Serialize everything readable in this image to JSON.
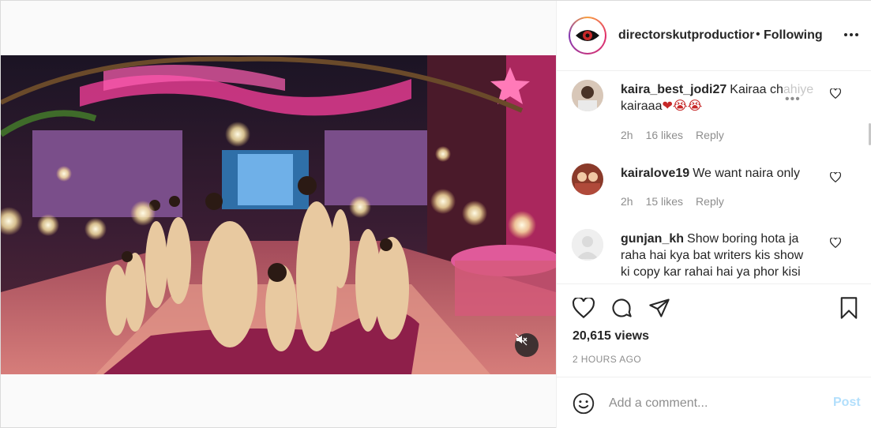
{
  "post": {
    "author": "directorskutproductions",
    "separator": "•",
    "follow_status": "Following",
    "more_icon": "more-horizontal-icon",
    "views": "20,615 views",
    "time": "2 HOURS AGO"
  },
  "comments": [
    {
      "user": "kaira_best_jodi27",
      "text_line1": "Kairaa ch",
      "text_faded": "ahiye",
      "text_line2": "kairaaa",
      "emojis": "❤😭😭",
      "time": "2h",
      "likes": "16 likes",
      "reply": "Reply"
    },
    {
      "user": "kairalove19",
      "text": "We want naira only",
      "time": "2h",
      "likes": "15 likes",
      "reply": "Reply"
    },
    {
      "user": "gunjan_kh",
      "text": "Show boring hota ja raha hai kya bat writers kis show ki copy kar rahai hai ya phor kisi"
    }
  ],
  "comment_box": {
    "placeholder": "Add a comment...",
    "post_label": "Post"
  },
  "icons": {
    "like": "heart-icon",
    "comment": "comment-icon",
    "share": "paper-plane-icon",
    "save": "bookmark-icon",
    "mute": "muted-speaker-icon",
    "emoji": "smiley-icon"
  },
  "colors": {
    "post_disabled": "#b2dffc",
    "meta_grey": "#8e8e8e",
    "text": "#262626"
  }
}
